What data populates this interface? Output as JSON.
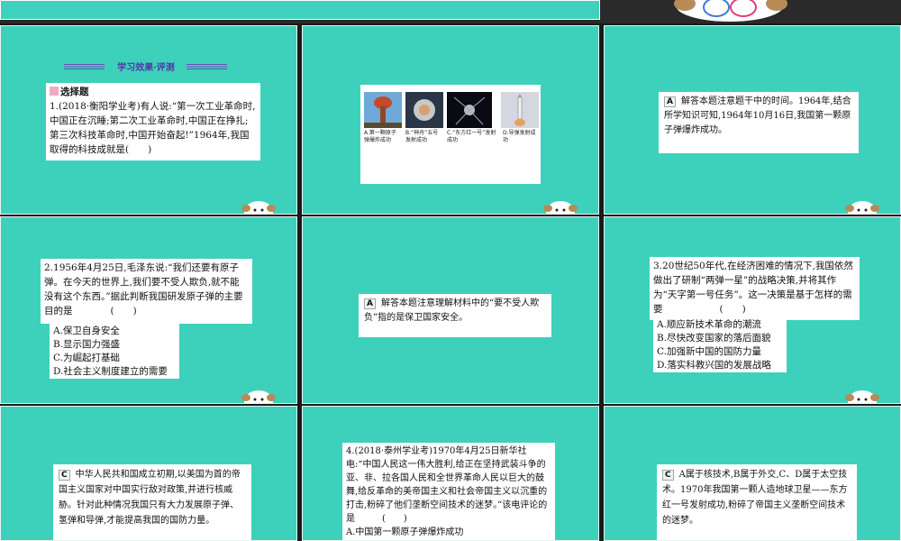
{
  "header": {
    "title": "学习效果·评测"
  },
  "q1": {
    "section": "选择题",
    "text": "1.(2018·衡阳学业考)有人说:“第一次工业革命时,中国正在沉睡;第二次工业革命时,中国正在挣扎;第三次科技革命时,中国开始奋起!”1964年,我国取得的科技成就是(　　)",
    "options": [
      "A.第一颗原子弹爆炸成功",
      "B.“神舟”五号发射成功",
      "C.“东方红一号”发射成功",
      "D.导弹发射成功"
    ],
    "answer_letter": "A",
    "answer_text": "解答本题注意题干中的时间。1964年,结合所学知识可知,1964年10月16日,我国第一颗原子弹爆炸成功。"
  },
  "q2": {
    "text": "2.1956年4月25日,毛泽东说:“我们还要有原子弹。在今天的世界上,我们要不受人欺负,就不能没有这个东西。”据此判断我国研发原子弹的主要目的是　　　　(　　)",
    "options": [
      "A.保卫自身安全",
      "B.显示国力强盛",
      "C.为崛起打基础",
      "D.社会主义制度建立的需要"
    ],
    "answer_letter": "A",
    "answer_text": "解答本题注意理解材料中的“要不受人欺负”指的是保卫国家安全。"
  },
  "q3": {
    "text": "3.20世纪50年代,在经济困难的情况下,我国依然做出了研制“两弹一星”的战略决策,并将其作为“天字第一号任务”。这一决策是基于怎样的需要　　　　　　(　　)",
    "options": [
      "A.顺应新技术革命的潮流",
      "B.尽快改变国家的落后面貌",
      "C.加强新中国的国防力量",
      "D.落实科教兴国的发展战略"
    ],
    "answer_letter": "C",
    "answer_text": "中华人民共和国成立初期,以美国为首的帝国主义国家对中国实行敌对政策,并进行核威胁。针对此种情况我国只有大力发展原子弹、氢弹和导弹,才能提高我国的国防力量。"
  },
  "q4": {
    "text": "4.(2018·泰州学业考)1970年4月25日新华社电:“中国人民这一伟大胜利,给正在坚持武装斗争的亚、非、拉各国人民和全世界革命人民以巨大的鼓舞,给反革命的美帝国主义和社会帝国主义以沉重的打击,粉碎了他们垄断空间技术的迷梦。”该电评论的是　　　(　　)",
    "options": [
      "A.中国第一颗原子弹爆炸成功"
    ],
    "answer_letter": "C",
    "answer_text": "A属于核技术,B属于外交,C、D属于太空技术。1970年我国第一颗人造地球卫星——东方红一号发射成功,粉碎了帝国主义垄断空间技术的迷梦。"
  },
  "colors": {
    "slide_bg": "#3dd1bc",
    "header_accent": "#4e37a6",
    "section_tag": "#f1aabf"
  }
}
